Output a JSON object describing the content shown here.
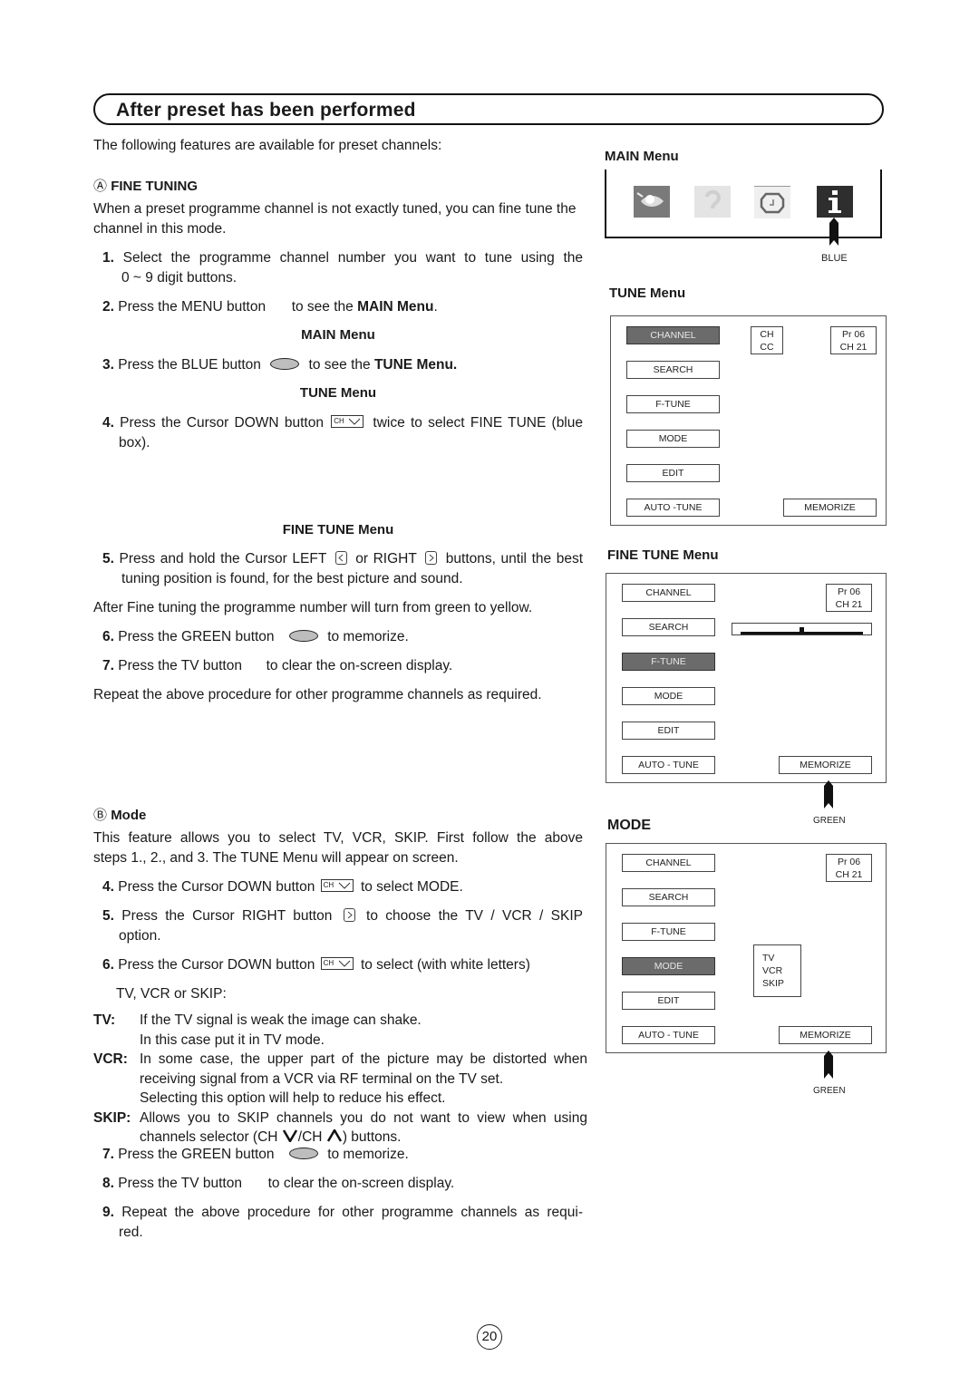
{
  "page": {
    "title": "After preset has been performed",
    "intro": "The following features are available for preset channels:",
    "page_number": "20"
  },
  "fine_tuning": {
    "badge": "Ⓐ",
    "heading": "FINE TUNING",
    "description": "When a preset programme channel is not exactly tuned, you can fine tune the channel in this mode.",
    "steps": [
      {
        "num": "1.",
        "text_a": "Select the programme channel number you want to tune using the",
        "text_b": "0 ~ 9 digit buttons."
      },
      {
        "num": "2.",
        "text_a": "Press the MENU button",
        "text_b": "to see the",
        "emph": "MAIN Menu",
        "tail": "."
      },
      {
        "num": "3.",
        "text_a": "Press the BLUE button",
        "text_b": "to see the",
        "emph": "TUNE Menu."
      },
      {
        "num": "4.",
        "text_a": "Press the Cursor DOWN button",
        "text_b": "twice to select FINE TUNE (blue",
        "text_c": "box)."
      },
      {
        "num": "5.",
        "text_a": "Press and hold the Cursor LEFT",
        "text_b": "or RIGHT",
        "text_c": "buttons, until the best",
        "text_d": "tuning position is found, for the best picture and sound."
      },
      {
        "num": "6.",
        "text_a": "Press the GREEN button",
        "text_b": "to memorize."
      },
      {
        "num": "7.",
        "text_a": "Press the TV button",
        "text_b": "to clear the on-screen display."
      }
    ],
    "sub_main_menu": "MAIN Menu",
    "sub_tune_menu": "TUNE Menu",
    "sub_fine_tune_menu": "FINE TUNE Menu",
    "after_note": "After Fine tuning the programme number will turn from green to yellow.",
    "repeat_note": "Repeat the above procedure for other programme channels as required."
  },
  "mode": {
    "badge": "Ⓑ",
    "heading": "Mode",
    "intro_a": "This feature allows you to select TV, VCR, SKIP. First follow the above",
    "intro_b": "steps 1., 2., and 3. The TUNE Menu will appear on screen.",
    "steps": [
      {
        "num": "4.",
        "text_a": "Press the Cursor DOWN button",
        "text_b": "to select MODE."
      },
      {
        "num": "5.",
        "text_a": "Press the Cursor RIGHT button",
        "text_b": "to choose the TV / VCR / SKIP",
        "text_c": "option."
      },
      {
        "num": "6.",
        "text_a": "Press the Cursor DOWN button",
        "text_b": "to select (with white letters)",
        "text_c": "TV, VCR or SKIP:"
      },
      {
        "num": "7.",
        "text_a": "Press the GREEN button",
        "text_b": "to memorize."
      },
      {
        "num": "8.",
        "text_a": "Press the TV button",
        "text_b": "to clear the on-screen display."
      },
      {
        "num": "9.",
        "text_a": "Repeat the above procedure for other programme channels as requi-",
        "text_b": "red."
      }
    ],
    "definitions": [
      {
        "term": "TV:",
        "lines": [
          "If the TV signal is weak the image can shake.",
          "In this case put it in TV mode."
        ]
      },
      {
        "term": "VCR:",
        "lines": [
          "In some case, the upper part of the picture may be distorted when",
          "receiving signal from a VCR via RF terminal on the TV set.",
          "Selecting this option will help to reduce his effect."
        ]
      },
      {
        "term": "SKIP:",
        "lines": [
          "Allows you to SKIP channels you do not want to view when using",
          "channels selector (CH",
          "/CH",
          ") buttons."
        ]
      }
    ]
  },
  "ch_button_label": "CH",
  "figures": {
    "main_menu": {
      "label": "MAIN Menu",
      "icons": [
        "picture-icon",
        "sound-icon",
        "timer-icon",
        "info-icon"
      ],
      "pointer_label": "BLUE"
    },
    "tune_menu": {
      "label": "TUNE Menu",
      "buttons": [
        "CHANNEL",
        "SEARCH",
        "F-TUNE",
        "MODE",
        "EDIT",
        "AUTO -TUNE"
      ],
      "selected": "CHANNEL",
      "ch_cc": [
        "CH",
        "CC"
      ],
      "program": [
        "Pr 06",
        "CH 21"
      ],
      "memorize": "MEMORIZE"
    },
    "fine_tune_menu": {
      "label": "FINE TUNE Menu",
      "buttons": [
        "CHANNEL",
        "SEARCH",
        "F-TUNE",
        "MODE",
        "EDIT",
        "AUTO - TUNE"
      ],
      "selected": "F-TUNE",
      "program": [
        "Pr 06",
        "CH 21"
      ],
      "memorize": "MEMORIZE",
      "tuning_position": 0.5,
      "pointer_label": "GREEN"
    },
    "mode_menu": {
      "label": "MODE",
      "buttons": [
        "CHANNEL",
        "SEARCH",
        "F-TUNE",
        "MODE",
        "EDIT",
        "AUTO - TUNE"
      ],
      "selected": "MODE",
      "program": [
        "Pr 06",
        "CH 21"
      ],
      "options": [
        "TV",
        "VCR",
        "SKIP"
      ],
      "memorize": "MEMORIZE",
      "pointer_label": "GREEN"
    }
  }
}
